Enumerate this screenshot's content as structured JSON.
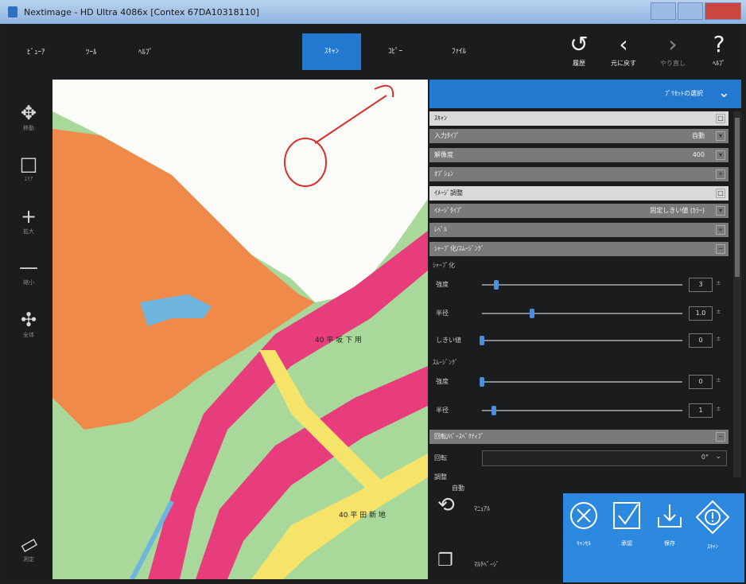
{
  "window": {
    "title": "Nextimage  -  HD Ultra 4086x [Contex 67DA10318110]"
  },
  "menu": {
    "items": [
      "ﾋﾞｭｰｱ",
      "ﾂｰﾙ",
      "ﾍﾙﾌﾟ"
    ],
    "tabs": [
      {
        "label": "ｽｷｬﾝ",
        "active": true
      },
      {
        "label": "ｺﾋﾟｰ",
        "active": false
      },
      {
        "label": "ﾌｧｲﾙ",
        "active": false
      }
    ],
    "tools": [
      {
        "icon": "history-icon",
        "label": "履歴"
      },
      {
        "icon": "undo-icon",
        "label": "元に戻す"
      },
      {
        "icon": "redo-icon",
        "label": "やり直し"
      },
      {
        "icon": "help-icon",
        "label": "ﾍﾙﾌﾟ"
      }
    ]
  },
  "leftbar": {
    "tools": [
      {
        "icon": "move-icon",
        "label": "移動"
      },
      {
        "icon": "select-rect-icon",
        "label": "ｴﾘｱ"
      },
      {
        "icon": "zoom-in-icon",
        "label": "拡大"
      },
      {
        "icon": "zoom-out-icon",
        "label": "縮小"
      },
      {
        "icon": "fit-icon",
        "label": "全体"
      },
      {
        "icon": "ruler-icon",
        "label": "測定"
      }
    ]
  },
  "panel": {
    "header": "ﾌﾟﾘｾｯﾄの選択",
    "sections": [
      {
        "label": "ｽｷｬﾝ",
        "style": "top",
        "value": "",
        "btn": "□"
      },
      {
        "label": "入力ﾀｲﾌﾟ",
        "style": "sub",
        "value": "自動",
        "btn": "▾"
      },
      {
        "label": "解像度",
        "style": "sub",
        "value": "400",
        "btn": "▾"
      },
      {
        "label": "ｵﾌﾟｼｮﾝ",
        "style": "sub",
        "value": "",
        "btn": "+"
      },
      {
        "label": "ｲﾒｰｼﾞ調整",
        "style": "top",
        "value": "",
        "btn": "□"
      },
      {
        "label": "ｲﾒｰｼﾞﾀｲﾌﾟ",
        "style": "sub",
        "value": "固定しきい値 (ｶﾗｰ)",
        "btn": "▾"
      },
      {
        "label": "ﾚﾍﾞﾙ",
        "style": "sub",
        "value": "",
        "btn": "+"
      },
      {
        "label": "ｼｬｰﾌﾟ化/ｽﾑｰｼﾞﾝｸﾞ",
        "style": "sub",
        "value": "",
        "btn": "−"
      }
    ],
    "sharpen_label": "ｼｬｰﾌﾟ化",
    "smoothing_label": "ｽﾑｰｼﾞﾝｸﾞ",
    "sharpen": [
      {
        "name": "強度",
        "value": "3",
        "level": 0.07
      },
      {
        "name": "半径",
        "value": "1.0",
        "level": 0.25
      },
      {
        "name": "しきい値",
        "value": "0",
        "level": 0.0
      }
    ],
    "smoothing": [
      {
        "name": "強度",
        "value": "0",
        "level": 0.0
      },
      {
        "name": "半径",
        "value": "1",
        "level": 0.06
      }
    ],
    "rotate_section": "回転/ﾊﾟｰｽﾍﾟｸﾃｨﾌﾞ",
    "rotate_label": "回転",
    "rotate_value": "0°",
    "adjust_label": "調整",
    "auto_label": "自動",
    "manual_label": "ﾏﾆｭｱﾙ",
    "multipage_label": "ﾏﾙﾁﾍﾟｰｼﾞ"
  },
  "actions": [
    {
      "icon": "cancel-icon",
      "label": "ｷｬﾝｾﾙ"
    },
    {
      "icon": "accept-icon",
      "label": "承認"
    },
    {
      "icon": "save-icon",
      "label": "保存"
    },
    {
      "icon": "warning-icon",
      "label": "ｽｷｬﾝ"
    }
  ],
  "map": {
    "labels": [
      "40 平 坂 下 用",
      "40 平 田 新 地"
    ]
  },
  "colors": {
    "accent": "#2378cf",
    "action_bg": "#2d88e0",
    "map_orange": "#f08a4b",
    "map_green": "#a8d89a",
    "map_pink": "#e83d7c",
    "map_yellow": "#f5e36a",
    "map_blue": "#6fb6de"
  }
}
